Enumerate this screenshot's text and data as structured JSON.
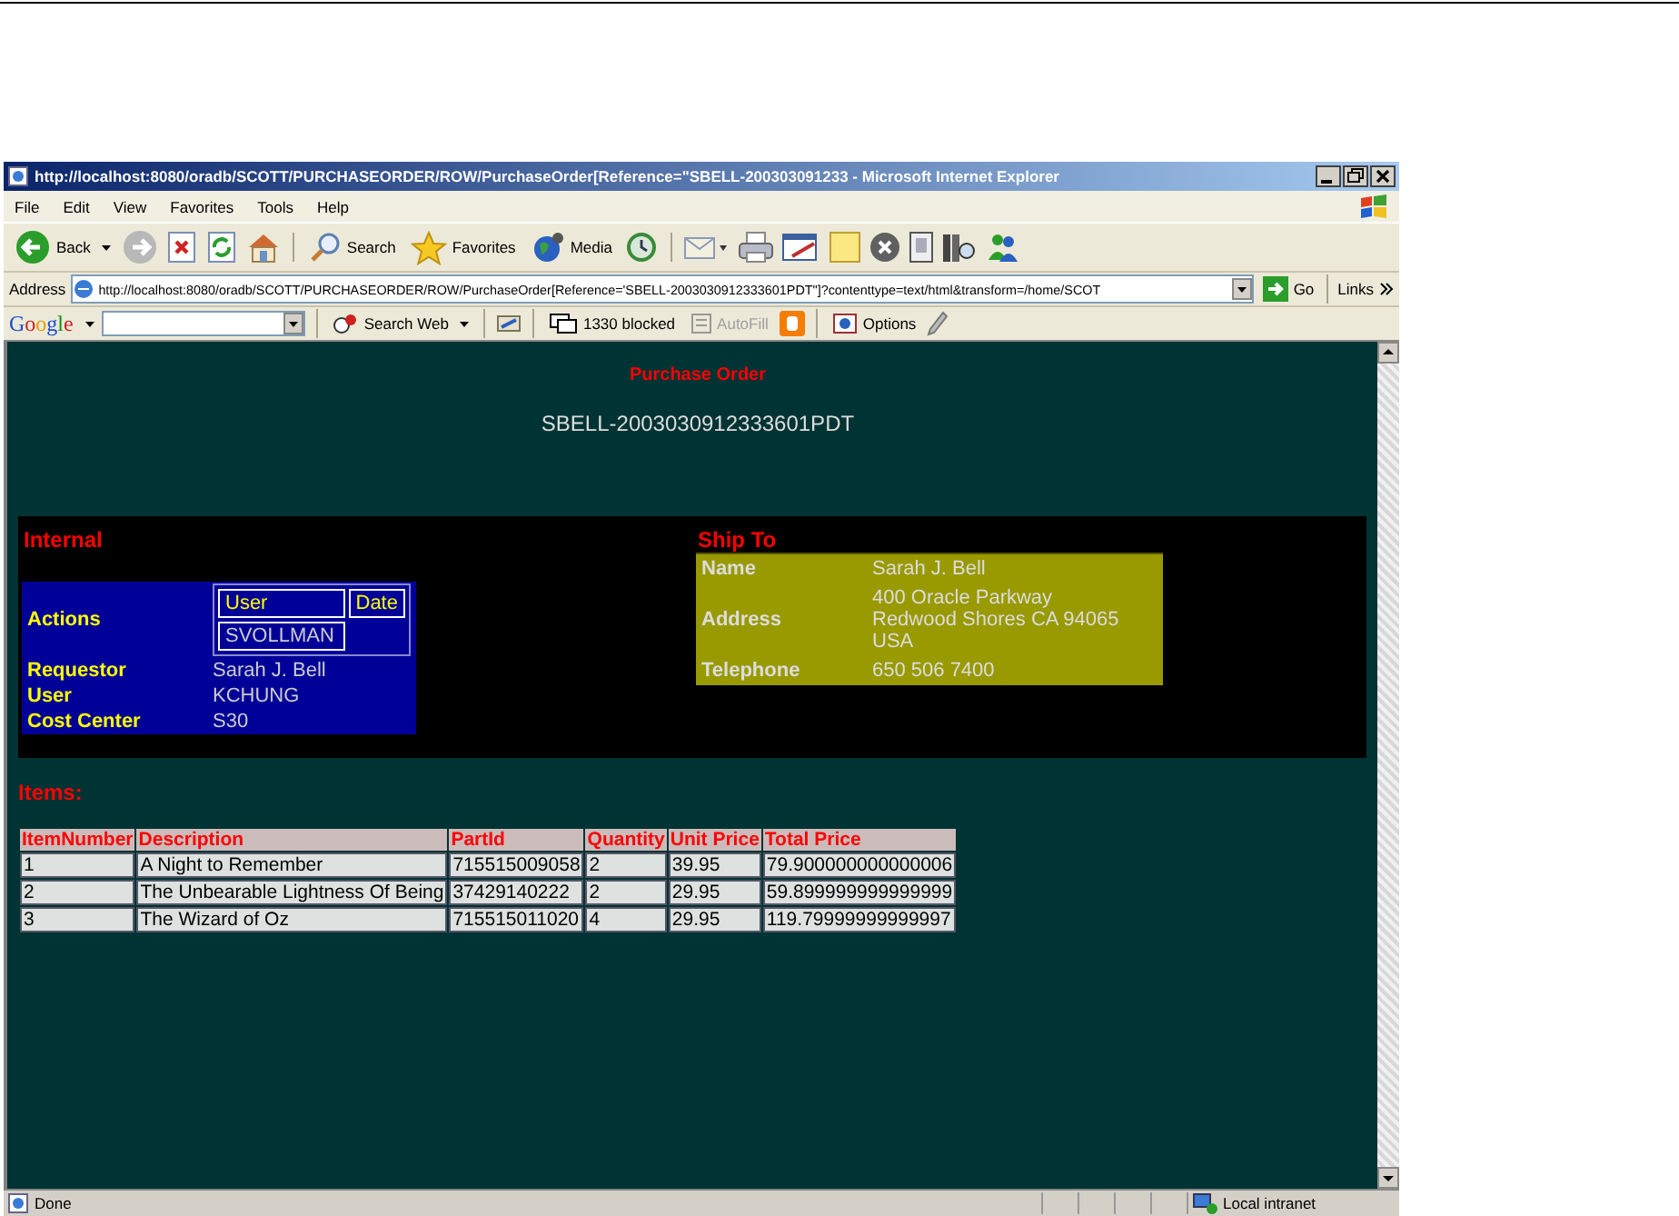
{
  "window": {
    "title": "http://localhost:8080/oradb/SCOTT/PURCHASEORDER/ROW/PurchaseOrder[Reference=\"SBELL-200303091233 - Microsoft Internet Explorer"
  },
  "menu": [
    "File",
    "Edit",
    "View",
    "Favorites",
    "Tools",
    "Help"
  ],
  "toolbar": {
    "back": "Back",
    "search": "Search",
    "favorites": "Favorites",
    "media": "Media"
  },
  "address_bar": {
    "label": "Address",
    "value": "http://localhost:8080/oradb/SCOTT/PURCHASEORDER/ROW/PurchaseOrder[Reference='SBELL-2003030912333601PDT\"]?contenttype=text/html&transform=/home/SCOT",
    "go": "Go",
    "links": "Links"
  },
  "google_bar": {
    "logo": "Google",
    "search_web": "Search Web",
    "blocked": "1330 blocked",
    "autofill": {
      "label": "AutoFill",
      "disabled": true
    },
    "options": "Options"
  },
  "page": {
    "title": "Purchase Order",
    "reference": "SBELL-2003030912333601PDT",
    "internal": {
      "heading": "Internal",
      "actions_label": "Actions",
      "actions_columns": [
        "User",
        "Date"
      ],
      "actions_rows": [
        [
          "SVOLLMAN"
        ]
      ],
      "fields": [
        {
          "label": "Requestor",
          "value": "Sarah J. Bell"
        },
        {
          "label": "User",
          "value": "KCHUNG"
        },
        {
          "label": "Cost Center",
          "value": "S30"
        }
      ]
    },
    "ship_to": {
      "heading": "Ship To",
      "fields": [
        {
          "label": "Name",
          "lines": [
            "Sarah J. Bell"
          ]
        },
        {
          "label": "Address",
          "lines": [
            "400 Oracle Parkway",
            "Redwood Shores CA 94065",
            "USA"
          ]
        },
        {
          "label": "Telephone",
          "lines": [
            "650 506 7400"
          ]
        }
      ]
    },
    "items": {
      "heading": "Items:",
      "columns": [
        "ItemNumber",
        "Description",
        "PartId",
        "Quantity",
        "Unit Price",
        "Total Price"
      ],
      "rows": [
        [
          "1",
          "A Night to Remember",
          "715515009058",
          "2",
          "39.95",
          "79.900000000000006"
        ],
        [
          "2",
          "The Unbearable Lightness Of Being",
          "37429140222",
          "2",
          "29.95",
          "59.899999999999999"
        ],
        [
          "3",
          "The Wizard of Oz",
          "715515011020",
          "4",
          "29.95",
          "119.79999999999997"
        ]
      ]
    }
  },
  "status_bar": {
    "text": "Done",
    "zone": "Local intranet"
  }
}
